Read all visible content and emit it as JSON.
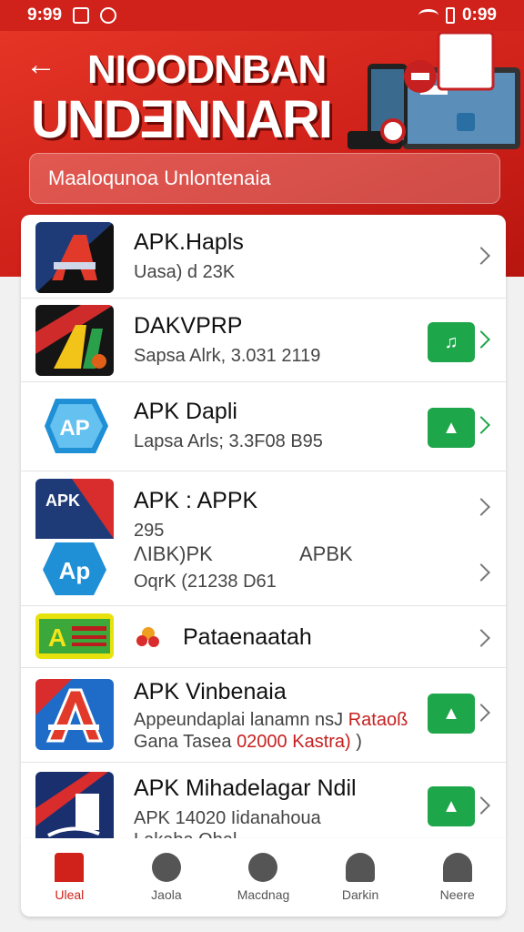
{
  "status_bar": {
    "time_left": "9:99",
    "time_right": "0:99"
  },
  "header": {
    "title_line1": "NIOODNBAN",
    "title_line2": "UNDƎNNARI",
    "search_placeholder": "Maaloqunoa Unlontenaia"
  },
  "apps": [
    {
      "name": "APK.Hapls",
      "sub": "Uasa) d 23K"
    },
    {
      "name": "DAKVPRP",
      "sub": "Sapsa Alrk, 3.031 2119"
    },
    {
      "name": "APK Dapli",
      "sub": "Lapsa Arls; 3.3F08 B95"
    },
    {
      "name": "APK : APPK",
      "sub_a": "295",
      "sub_b": "ΛIBK)PK",
      "sub_c": "APBK",
      "sub_d": "OqrK (21238 D61"
    },
    {
      "name": "Pataenaatah"
    },
    {
      "name": "APK Vinbenaia",
      "sub_a": "Appeundaplai lanamn nsJ",
      "sub_highlight": "Rataoß",
      "sub_b": "Gana Tasea",
      "sub_c": "02000 Kastra)",
      "sub_d": ")"
    },
    {
      "name": "APK Mihadelagar Ndil",
      "sub_a": "APK 14020 Iidanahoua",
      "sub_b": "Lakaba Obal"
    }
  ],
  "bottom_nav": [
    {
      "label": "Uleal",
      "icon": "home-icon"
    },
    {
      "label": "Jaola",
      "icon": "face-icon"
    },
    {
      "label": "Macdnag",
      "icon": "h-icon"
    },
    {
      "label": "Darkin",
      "icon": "people-icon"
    },
    {
      "label": "Neere",
      "icon": "profile-icon"
    }
  ],
  "colors": {
    "brand_red": "#d0211a",
    "download_green": "#1ea64a"
  }
}
